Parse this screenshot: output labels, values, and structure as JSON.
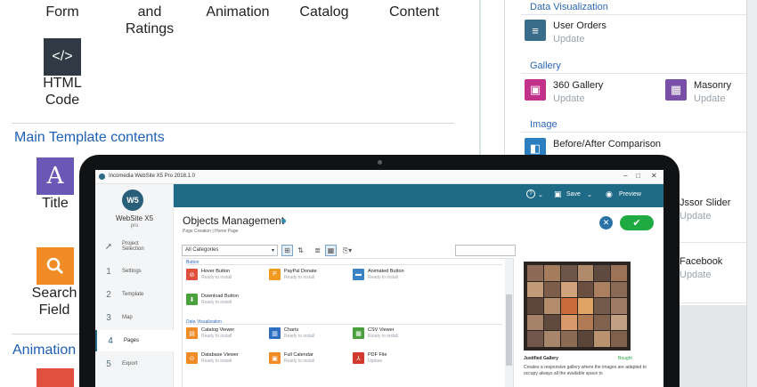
{
  "bg_left": {
    "top_items": [
      {
        "label": "Form"
      },
      {
        "label": "and\nRatings"
      },
      {
        "label": "Animation"
      },
      {
        "label": "Catalog"
      },
      {
        "label": "Content"
      }
    ],
    "html_code": {
      "label": "HTML\nCode",
      "icon": "code-icon",
      "color": "#2f3a44"
    },
    "main_template_heading": "Main Template contents",
    "title_item": {
      "label": "Title",
      "icon": "letter-a-icon",
      "glyph": "A",
      "color": "#6b57b5"
    },
    "search_item": {
      "label": "Search\nField",
      "icon": "search-icon",
      "color": "#f08b25"
    },
    "animation_heading": "Animation"
  },
  "bg_right": {
    "data_viz_heading": "Data Visualization",
    "user_orders": {
      "title": "User Orders",
      "sub": "Update"
    },
    "gallery_heading": "Gallery",
    "gallery_items": [
      {
        "title": "360 Gallery",
        "sub": "Update",
        "color": "#c2328a"
      },
      {
        "title": "Masonry",
        "sub": "Update",
        "color": "#7a4fa8"
      }
    ],
    "image_heading": "Image",
    "before_after": {
      "title": "Before/After Comparison"
    },
    "jssor": {
      "title": "Jssor Slider",
      "sub": "Update"
    },
    "facebook": {
      "title": "Facebook",
      "sub": "Update"
    }
  },
  "app": {
    "window_title": "Incomedia WebSite X5 Pro 2018.1.0",
    "logo_mark": "W5",
    "logo_name": "WebSite X5",
    "logo_edition": "pro",
    "steps": [
      {
        "num": "",
        "label": "Project\nSelection"
      },
      {
        "num": "1",
        "label": "Settings"
      },
      {
        "num": "2",
        "label": "Template"
      },
      {
        "num": "3",
        "label": "Map"
      },
      {
        "num": "4",
        "label": "Pages"
      },
      {
        "num": "5",
        "label": "Export"
      }
    ],
    "topbar": {
      "help": "?",
      "save": "Save",
      "preview": "Preview"
    },
    "heading": "Objects Management",
    "breadcrumb": "Page Creation | Home Page",
    "category_value": "All Categories",
    "groups": {
      "button": "Button",
      "data_viz": "Data Visualization"
    },
    "button_items": [
      {
        "title": "Hover Button",
        "sub": "Ready to install",
        "color": "#e0503d"
      },
      {
        "title": "PayPal Donate",
        "sub": "Ready to install",
        "color": "#f09a20"
      },
      {
        "title": "Animated Button",
        "sub": "Ready to install",
        "color": "#3b83c4"
      },
      {
        "title": "Download Button",
        "sub": "Ready to install",
        "color": "#4aa03c"
      }
    ],
    "dataviz_items": [
      {
        "title": "Catalog Viewer",
        "sub": "Ready to install",
        "color": "#f08b25"
      },
      {
        "title": "Charts",
        "sub": "Ready to install",
        "color": "#2f6fc2"
      },
      {
        "title": "CSV Viewer",
        "sub": "Ready to install",
        "color": "#4aa03c"
      },
      {
        "title": "Database Viewer",
        "sub": "Ready to install",
        "color": "#f08b25"
      },
      {
        "title": "Full Calendar",
        "sub": "Ready to install",
        "color": "#f08b25"
      },
      {
        "title": "PDF File",
        "sub": "Update",
        "color": "#d23a2e"
      }
    ],
    "preview": {
      "title": "Justified Gallery",
      "badge": "Bought",
      "desc": "Creates a responsive gallery where the images are adapted to occupy always all the available space to"
    }
  }
}
